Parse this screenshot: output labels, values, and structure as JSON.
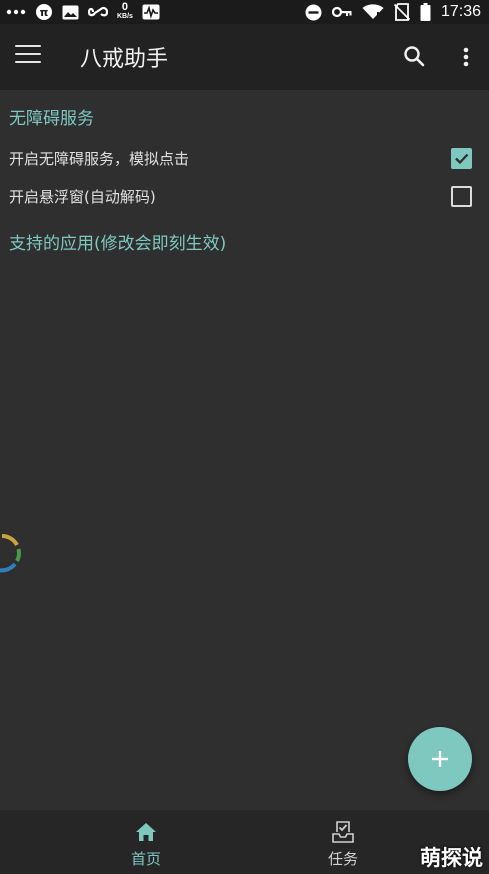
{
  "status_bar": {
    "icons_left": [
      "dots-icon",
      "pi-icon",
      "image-icon",
      "infinity-icon",
      "heart-monitor-icon"
    ],
    "net_speed_value": "0",
    "net_speed_unit": "KB/s",
    "icons_right": [
      "do-not-disturb-icon",
      "key-icon",
      "wifi-icon",
      "no-sim-icon",
      "battery-icon"
    ],
    "time": "17:36"
  },
  "app_bar": {
    "title": "八戒助手",
    "menu_icon": "hamburger-icon",
    "search_icon": "search-icon",
    "more_icon": "more-vert-icon"
  },
  "accessibility": {
    "header": "无障碍服务",
    "options": [
      {
        "label": "开启无障碍服务，模拟点击",
        "checked": true
      },
      {
        "label": "开启悬浮窗(自动解码)",
        "checked": false
      }
    ]
  },
  "apps_section": {
    "header": "支持的应用(修改会即刻生效)"
  },
  "fab": {
    "icon": "plus-icon"
  },
  "bottom_nav": {
    "items": [
      {
        "label": "首页",
        "icon": "home-icon",
        "active": true
      },
      {
        "label": "任务",
        "icon": "tray-check-icon",
        "active": false
      }
    ]
  },
  "watermark": "萌探说",
  "colors": {
    "accent": "#7ec8bf",
    "background": "#2f2f2f",
    "app_bar": "#222222",
    "status_bar": "#1b1b1b"
  }
}
